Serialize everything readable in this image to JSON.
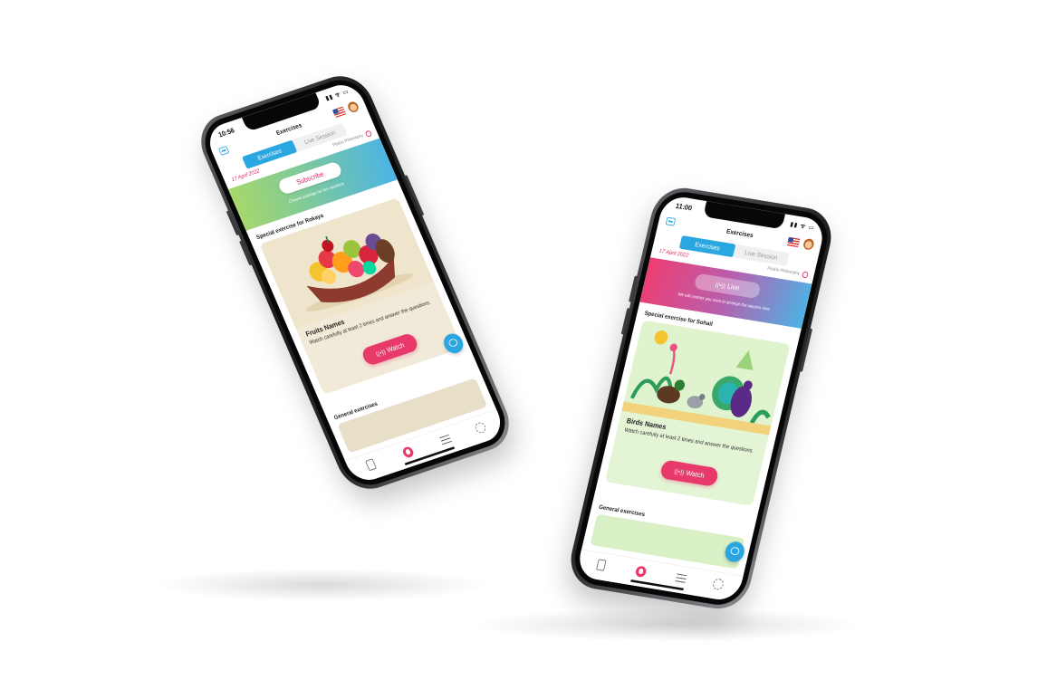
{
  "colors": {
    "accent_blue": "#2aa7e0",
    "accent_pink": "#e0245e",
    "watch_button": "#e83a6a",
    "card_bg_fruits": "#f1ead8",
    "card_bg_birds": "#e4f5d6"
  },
  "phones": [
    {
      "status": {
        "time": "10:56",
        "icons": "▮▮ ᯤ ▭"
      },
      "header": {
        "title": "Exercises",
        "menu_icon": "menu-icon",
        "flag_icon": "us-flag-icon",
        "avatar_icon": "profile-avatar"
      },
      "tabs": [
        {
          "label": "Exercises",
          "active": true
        },
        {
          "label": "Live Session",
          "active": false
        }
      ],
      "date": "17 April 2022",
      "teacher": "PitaDo Philosophy",
      "banner": {
        "button_label": "Subscribe",
        "button_icon": "",
        "subtitle": "Choose package for live sessions",
        "gradient": [
          "#a8d86a",
          "#4bb4e6"
        ]
      },
      "special_title": "Special exercise for Rokaya",
      "exercise": {
        "name": "Fruits Names",
        "description": "Watch carefully at least 2 times and answer the questions.",
        "watch_label": "Watch",
        "watch_icon": "live-broadcast-icon",
        "illustration": "fruit-basket-illustration"
      },
      "general_title": "General exercises",
      "nav": [
        "book-icon",
        "home-hand-icon",
        "list-icon",
        "settings-gear-icon"
      ]
    },
    {
      "status": {
        "time": "11:00",
        "icons": "▮▮ ᯤ ▭"
      },
      "header": {
        "title": "Exercises",
        "menu_icon": "menu-icon",
        "flag_icon": "us-flag-icon",
        "avatar_icon": "profile-avatar"
      },
      "tabs": [
        {
          "label": "Exercises",
          "active": true
        },
        {
          "label": "Live Session",
          "active": false
        }
      ],
      "date": "17 April 2022",
      "teacher": "PitaDo Philosophy",
      "banner": {
        "button_label": "Live",
        "button_icon": "((•))",
        "subtitle": "We will contact you soon to arrange the session time",
        "gradient": [
          "#ee3d71",
          "#4bb4e6"
        ]
      },
      "special_title": "Special exercise for Sohail",
      "exercise": {
        "name": "Birds Names",
        "description": "Watch carefully at least 2 times and answer the questions.",
        "watch_label": "Watch",
        "watch_icon": "live-broadcast-icon",
        "illustration": "birds-illustration"
      },
      "general_title": "General exercises",
      "nav": [
        "book-icon",
        "home-hand-icon",
        "list-icon",
        "settings-gear-icon"
      ]
    }
  ]
}
